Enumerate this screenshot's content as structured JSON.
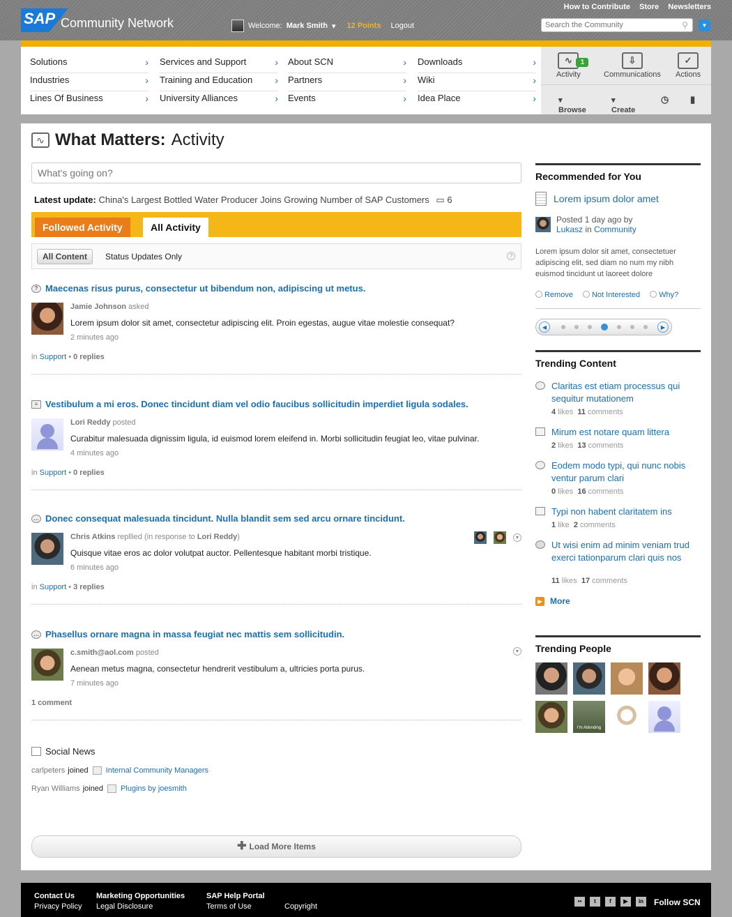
{
  "header": {
    "toplinks": [
      "How to Contribute",
      "Store",
      "Newsletters"
    ],
    "logo": "SAP",
    "brand": "Community Network",
    "welcome_label": "Welcome:",
    "user_name": "Mark Smith",
    "points": "12 Points",
    "logout": "Logout",
    "search_placeholder": "Search the Community"
  },
  "nav": {
    "col1": [
      "Solutions",
      "Industries",
      "Lines Of Business"
    ],
    "col2": [
      "Services and Support",
      "Training and Education",
      "University Alliances"
    ],
    "col3": [
      "About SCN",
      "Partners",
      "Events"
    ],
    "col4": [
      "Downloads",
      "Wiki",
      "Idea Place"
    ],
    "tools": {
      "activity": "Activity",
      "activity_badge": "1",
      "communications": "Communications",
      "actions": "Actions",
      "browse": "Browse",
      "create": "Create"
    }
  },
  "page": {
    "title_bold": "What Matters:",
    "title_rest": "Activity",
    "status_placeholder": "What's going on?",
    "latest_label": "Latest update:",
    "latest_text": "China's Largest Bottled Water Producer Joins Growing Number of SAP Customers",
    "latest_count": "6",
    "tab_followed": "Followed Activity",
    "tab_all": "All Activity",
    "filter_all": "All Content",
    "filter_status": "Status Updates Only"
  },
  "posts": [
    {
      "title": "Maecenas risus purus, consectetur ut bibendum non, adipiscing ut metus.",
      "author": "Jamie Johnson",
      "action": "asked",
      "body": "Lorem ipsum dolor sit amet, consectetur adipiscing elit. Proin egestas, augue vitae molestie consequat?",
      "time": "2 minutes ago",
      "in": "in",
      "place": "Support",
      "replies": "0 replies"
    },
    {
      "title": "Vestibulum a mi eros. Donec tincidunt diam vel odio faucibus sollicitudin imperdiet ligula sodales.",
      "author": "Lori Reddy",
      "action": "posted",
      "body": "Curabitur malesuada dignissim ligula, id euismod lorem eleifend in. Morbi sollicitudin feugiat leo, vitae pulvinar.",
      "time": "4 minutes ago",
      "in": "in",
      "place": "Support",
      "replies": "0 replies"
    },
    {
      "title": "Donec consequat malesuada tincidunt. Nulla blandit sem sed arcu ornare tincidunt.",
      "author": "Chris Atkins",
      "action": "repllied (in response to",
      "response_to": "Lori Reddy",
      "action_end": ")",
      "body": "Quisque vitae eros ac dolor volutpat auctor. Pellentesque habitant morbi tristique.",
      "time": "6 minutes ago",
      "in": "in",
      "place": "Support",
      "replies": "3 replies"
    },
    {
      "title": "Phasellus ornare magna in massa feugiat nec mattis sem sollicitudin.",
      "author": "c.smith@aol.com",
      "action": "posted",
      "body": "Aenean metus magna, consectetur hendrerit vestibulum a, ultricies porta purus.",
      "time": "7 minutes ago",
      "comments": "1 comment"
    }
  ],
  "social": {
    "title": "Social News",
    "items": [
      {
        "user": "carlpeters",
        "verb": "joined",
        "group": "Internal Community Managers"
      },
      {
        "user": "Ryan Williams",
        "verb": "joined",
        "group": "Plugins by joesmith"
      }
    ]
  },
  "load_more": "Load More Items",
  "sidebar": {
    "rec_head": "Recommended for You",
    "rec_title": "Lorem ipsum dolor amet",
    "rec_posted": "Posted 1 day ago by",
    "rec_author": "Lukasz",
    "rec_in": "in",
    "rec_place": "Community",
    "rec_text": "Lorem ipsum dolor sit amet, consectetuer adipiscing elit, sed diam no num my nibh euismod tincidunt ut laoreet dolore",
    "remove": "Remove",
    "not_interested": "Not Interested",
    "why": "Why?",
    "trending_head": "Trending Content",
    "trending": [
      {
        "title": "Claritas est etiam processus qui sequitur mutationem",
        "likes": "4",
        "likes_label": "likes",
        "comments": "11",
        "comments_label": "comments"
      },
      {
        "title": "Mirum est notare quam littera",
        "likes": "2",
        "likes_label": "likes",
        "comments": "13",
        "comments_label": "comments"
      },
      {
        "title": "Eodem modo typi, qui nunc nobis ventur parum clari",
        "likes": "0",
        "likes_label": "likes",
        "comments": "16",
        "comments_label": "comments"
      },
      {
        "title": "Typi non habent claritatem ins",
        "likes": "1",
        "likes_label": "like",
        "comments": "2",
        "comments_label": "comments"
      },
      {
        "title": "Ut wisi enim ad minim veniam trud exerci tationparum clari quis nos",
        "likes": "11",
        "likes_label": "likes",
        "comments": "17",
        "comments_label": "comments"
      }
    ],
    "more": "More",
    "people_head": "Trending People",
    "attending_label": "I'm Attending"
  },
  "footer": {
    "col1": [
      "Contact Us",
      "Privacy Policy"
    ],
    "col2": [
      "Marketing Opportunities",
      "Legal Disclosure"
    ],
    "col3": [
      "SAP Help Portal",
      "Terms of Use"
    ],
    "copyright": "Copyright",
    "follow": "Follow SCN"
  }
}
